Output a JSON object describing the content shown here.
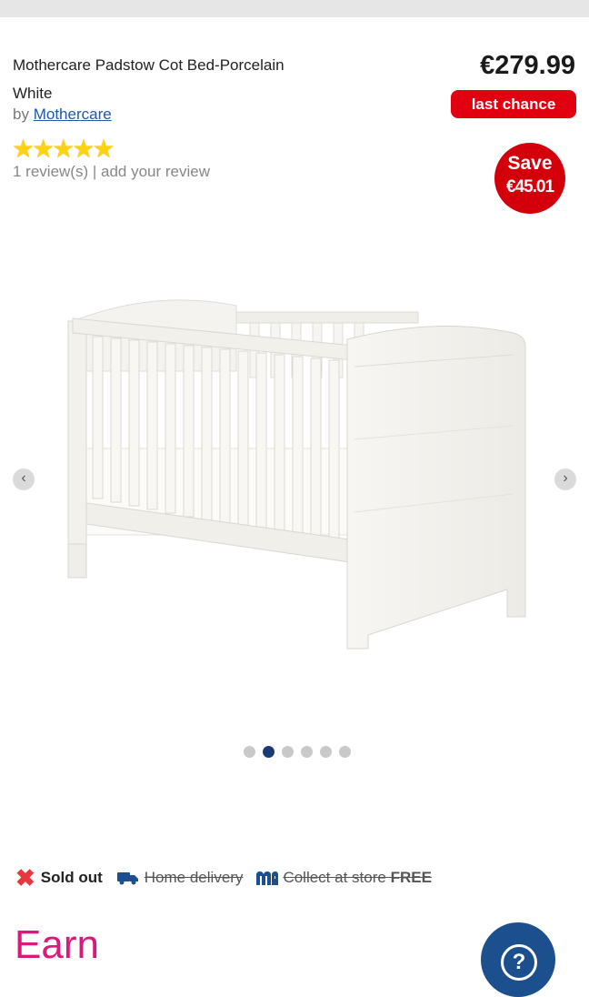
{
  "product": {
    "title": "Mothercare Padstow Cot Bed-Porcelain White",
    "by_prefix": "by",
    "brand": "Mothercare",
    "rating": 5,
    "reviews_text": "1 review(s) | add your review",
    "price": "€279.99",
    "badge": "last chance",
    "save_label": "Save",
    "save_amount": "€45.01"
  },
  "gallery": {
    "image_count": 6,
    "active_index": 1,
    "prev_icon": "chevron-left-icon",
    "next_icon": "chevron-right-icon"
  },
  "availability": {
    "sold_out": "Sold out",
    "home_delivery": "Home delivery",
    "collect_prefix": "Collect at store",
    "collect_free": "FREE"
  },
  "promo": {
    "earn": "Earn"
  },
  "help": {
    "icon": "help-icon",
    "label": "?"
  },
  "colors": {
    "accent_red": "#e1000f",
    "brand_blue": "#1b4f8e",
    "earn_pink": "#d81b7a",
    "star_yellow": "#ffd20f"
  }
}
